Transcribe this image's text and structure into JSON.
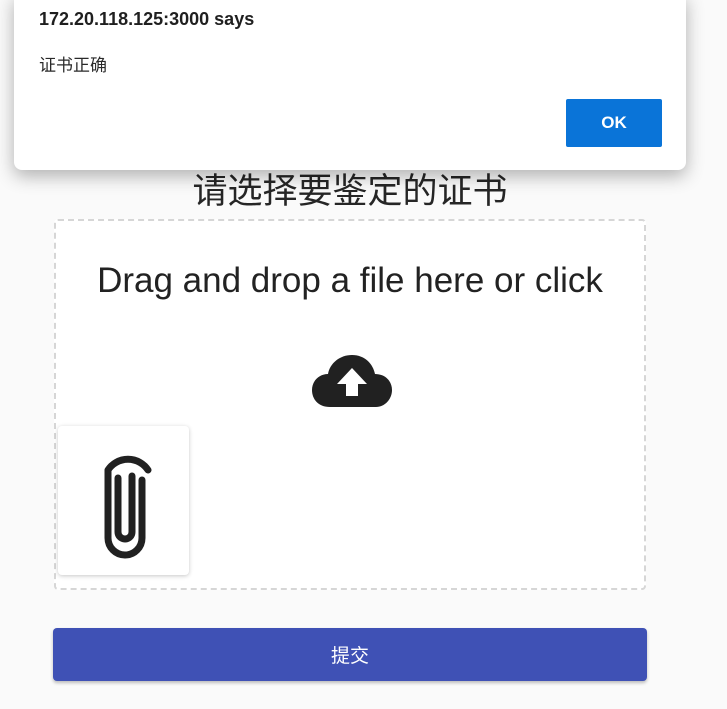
{
  "alert": {
    "origin": "172.20.118.125:3000 says",
    "message": "证书正确",
    "ok_label": "OK"
  },
  "main": {
    "title": "请选择要鉴定的证书",
    "dropzone_text": "Drag and drop a file here or click",
    "upload_icon": "cloud-upload-icon",
    "file_icon": "paperclip-icon",
    "submit_label": "提交"
  },
  "colors": {
    "primary": "#3f51b5",
    "dialog_accent": "#0a74d8"
  }
}
